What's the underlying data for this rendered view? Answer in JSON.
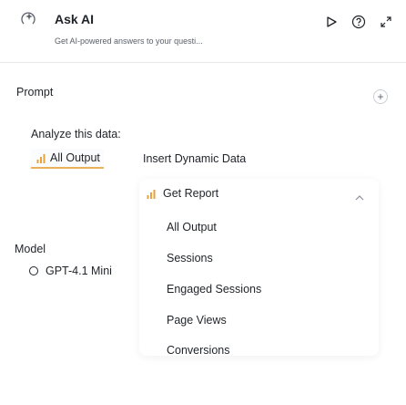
{
  "header": {
    "title": "Ask AI",
    "subtitle": "Get AI-powered answers to your questi...",
    "icons": [
      "sparkle-icon",
      "play-icon",
      "help-icon",
      "expand-icon"
    ]
  },
  "prompt": {
    "label": "Prompt",
    "text": "Analyze this data:",
    "chip_label": "All Output",
    "insert_link": "Insert Dynamic Data"
  },
  "model": {
    "label": "Model",
    "selected": "GPT-4.1 Mini"
  },
  "dropdown": {
    "header": "Get Report",
    "items": [
      "All Output",
      "Sessions",
      "Engaged Sessions",
      "Page Views",
      "Conversions"
    ]
  },
  "colors": {
    "chip_underline": "#e8b15a",
    "chart_icon": "#e8a23c",
    "text": "#1f2328",
    "muted": "#5b616b"
  }
}
